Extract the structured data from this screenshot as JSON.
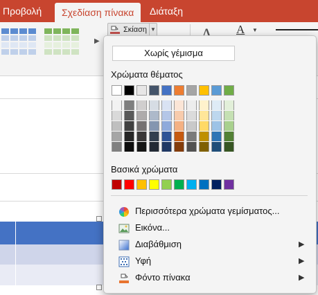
{
  "ribbon": {
    "tabs": [
      {
        "label": "Προβολή"
      },
      {
        "label": "Σχεδίαση πίνακα"
      },
      {
        "label": "Διάταξη"
      }
    ],
    "shading_button": {
      "label": "Σκίαση"
    },
    "pen_color_letter": "A",
    "pen_style_letter": "A"
  },
  "menu": {
    "no_fill": "Χωρίς γέμισμα",
    "theme_colors_title": "Χρώματα θέματος",
    "theme_colors": [
      "#ffffff",
      "#000000",
      "#e7e6e6",
      "#44546a",
      "#4472c4",
      "#ed7d31",
      "#a5a5a5",
      "#ffc000",
      "#5b9bd5",
      "#70ad47"
    ],
    "theme_shades": [
      [
        "#f2f2f2",
        "#d9d9d9",
        "#bfbfbf",
        "#a6a6a6",
        "#808080"
      ],
      [
        "#7f7f7f",
        "#595959",
        "#404040",
        "#262626",
        "#0d0d0d"
      ],
      [
        "#d0cece",
        "#aeabab",
        "#757171",
        "#3a3838",
        "#161616"
      ],
      [
        "#d6dce4",
        "#adb9ca",
        "#8496b0",
        "#323f4f",
        "#222a35"
      ],
      [
        "#d9e2f3",
        "#b4c6e7",
        "#8eaadb",
        "#2f5496",
        "#1f3864"
      ],
      [
        "#fbe5d6",
        "#f7cbac",
        "#f4b183",
        "#c55a11",
        "#833c0b"
      ],
      [
        "#ededed",
        "#dbdbdb",
        "#c9c9c9",
        "#7b7b7b",
        "#525252"
      ],
      [
        "#fff2cc",
        "#ffe699",
        "#ffd966",
        "#bf9000",
        "#7f6000"
      ],
      [
        "#deebf6",
        "#bdd7ee",
        "#9dc3e6",
        "#2e75b5",
        "#1f4e79"
      ],
      [
        "#e2efd9",
        "#c5e0b3",
        "#a8d08d",
        "#538135",
        "#375623"
      ]
    ],
    "standard_colors_title": "Βασικά χρώματα",
    "standard_colors": [
      "#c00000",
      "#ff0000",
      "#ffc000",
      "#ffff00",
      "#92d050",
      "#00b050",
      "#00b0f0",
      "#0070c0",
      "#002060",
      "#7030a0"
    ],
    "items": [
      {
        "label": "Περισσότερα χρώματα γεμίσματος...",
        "icon": "color-wheel-icon",
        "submenu": false
      },
      {
        "label": "Εικόνα...",
        "icon": "picture-icon",
        "submenu": false
      },
      {
        "label": "Διαβάθμιση",
        "icon": "gradient-icon",
        "submenu": true
      },
      {
        "label": "Υφή",
        "icon": "texture-icon",
        "submenu": true
      },
      {
        "label": "Φόντο πίνακα",
        "icon": "table-background-icon",
        "submenu": true
      }
    ]
  },
  "colors": {
    "ribbon_accent": "#c8452f",
    "table_header": "#4472c4",
    "table_band": "#cfd5ea"
  }
}
